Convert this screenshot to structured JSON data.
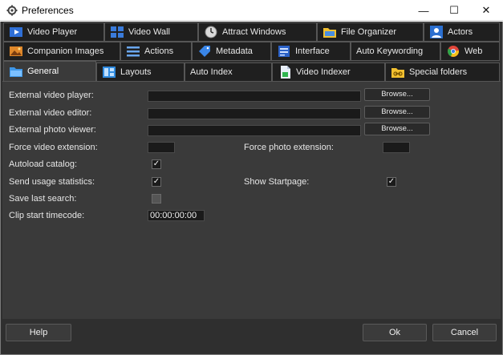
{
  "window": {
    "title": "Preferences",
    "controls": {
      "minimize": "—",
      "maximize": "☐",
      "close": "✕"
    }
  },
  "tabs": {
    "row1": [
      {
        "label": "Video Player",
        "icon": "video-player-icon"
      },
      {
        "label": "Video Wall",
        "icon": "video-wall-icon"
      },
      {
        "label": "Attract Windows",
        "icon": "clock-icon"
      },
      {
        "label": "File Organizer",
        "icon": "folder-icon"
      },
      {
        "label": "Actors",
        "icon": "person-icon"
      }
    ],
    "row2": [
      {
        "label": "Companion Images",
        "icon": "image-icon"
      },
      {
        "label": "Actions",
        "icon": "list-icon"
      },
      {
        "label": "Metadata",
        "icon": "tag-icon"
      },
      {
        "label": "Interface",
        "icon": "interface-icon"
      },
      {
        "label": "Auto Keywording",
        "icon": ""
      },
      {
        "label": "Web",
        "icon": "chrome-icon"
      }
    ],
    "row3": [
      {
        "label": "General",
        "icon": "folder-blue-icon",
        "active": true
      },
      {
        "label": "Layouts",
        "icon": "layout-icon"
      },
      {
        "label": "Auto Index",
        "icon": ""
      },
      {
        "label": "Video Indexer",
        "icon": "document-icon"
      },
      {
        "label": "Special folders",
        "icon": "link-folder-icon"
      }
    ]
  },
  "general": {
    "external_video_player": {
      "label": "External video player:",
      "value": "",
      "browse": "Browse..."
    },
    "external_video_editor": {
      "label": "External video editor:",
      "value": "",
      "browse": "Browse..."
    },
    "external_photo_viewer": {
      "label": "External photo viewer:",
      "value": "",
      "browse": "Browse..."
    },
    "force_video_extension": {
      "label": "Force video extension:",
      "value": ""
    },
    "force_photo_extension": {
      "label": "Force photo extension:",
      "value": ""
    },
    "autoload_catalog": {
      "label": "Autoload catalog:",
      "checked": true
    },
    "send_usage_statistics": {
      "label": "Send usage statistics:",
      "checked": true
    },
    "show_startpage": {
      "label": "Show Startpage:",
      "checked": true
    },
    "save_last_search": {
      "label": "Save last search:",
      "checked": false
    },
    "clip_start_timecode": {
      "label": "Clip start timecode:",
      "value": "00:00:00:00"
    },
    "check_mark": "✓"
  },
  "footer": {
    "help": "Help",
    "ok": "Ok",
    "cancel": "Cancel"
  },
  "colors": {
    "background": "#2f2f2f",
    "panel": "#3a3a3a",
    "tab": "#1f1f1f",
    "text": "#e6e6e6"
  }
}
